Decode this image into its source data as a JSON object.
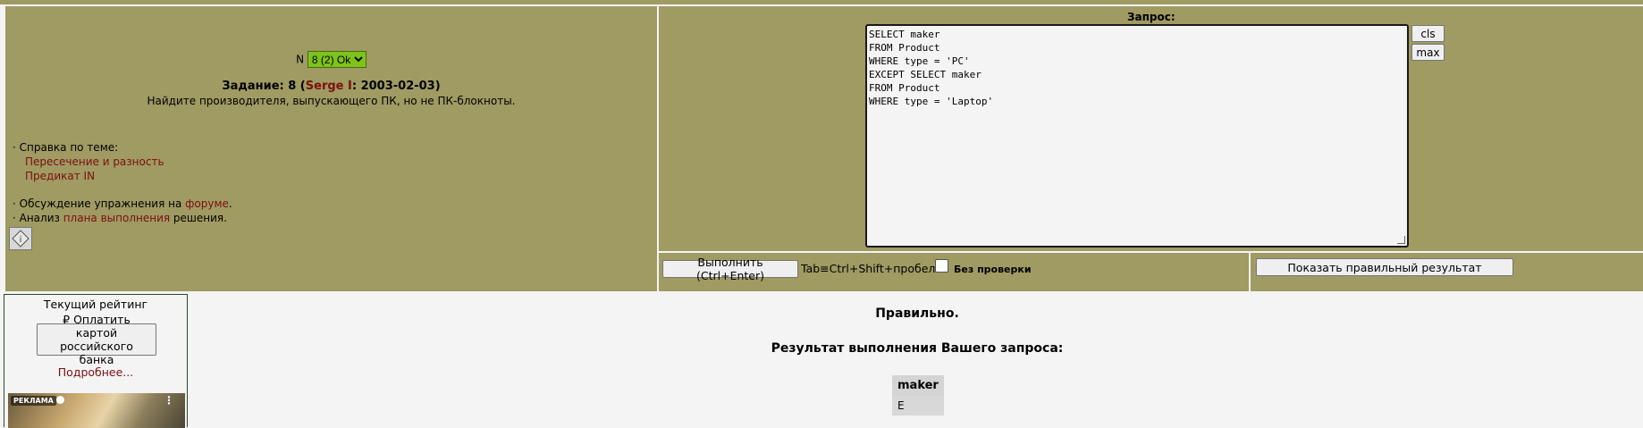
{
  "task": {
    "n_label": "N",
    "n_selected": "8 (2) Ok",
    "title_prefix": "Задание: 8 (",
    "author": "Serge I",
    "title_date": ": 2003-02-03)",
    "description": "Найдите производителя, выпускающего ПК, но не ПК-блокноты."
  },
  "help": {
    "heading": "· Справка по теме:",
    "links": [
      "Пересечение и разность",
      "Предикат IN"
    ],
    "forum_prefix": "· Обсуждение упражнения на ",
    "forum_link": "форуме",
    "forum_suffix": ".",
    "plan_prefix": "· Анализ ",
    "plan_link": "плана выполнения",
    "plan_suffix": " решения."
  },
  "query": {
    "label": "Запрос:",
    "lines": [
      "SELECT maker",
      "FROM Product",
      "WHERE type = 'PC'",
      "EXCEPT SELECT maker",
      "FROM Product",
      "WHERE type = 'Laptop'"
    ],
    "cls_label": "cls",
    "max_label": "max"
  },
  "run": {
    "button_label": "Выполнить (Ctrl+Enter)",
    "shortcut_hint": "Tab≡Ctrl+Shift+пробел",
    "no_check_label": "Без  проверки",
    "show_result_label": "Показать правильный результат"
  },
  "sidebar": {
    "rating_title": "Текущий рейтинг",
    "pay_button": "₽ Оплатить картой российского банка",
    "more_link": "Подробнее...",
    "ad_label": "РЕКЛАМА",
    "ad_menu_icon": "more-vertical-icon"
  },
  "result": {
    "status": "Правильно.",
    "heading": "Результат выполнения Вашего запроса:",
    "columns": [
      "maker"
    ],
    "rows": [
      [
        "E"
      ]
    ]
  }
}
